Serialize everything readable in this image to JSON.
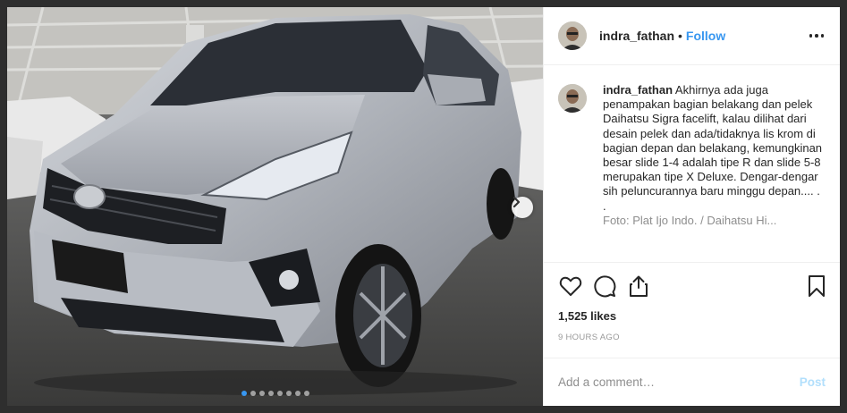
{
  "header": {
    "username": "indra_fathan",
    "separator": "•",
    "follow_label": "Follow"
  },
  "caption": {
    "username": "indra_fathan",
    "text": "Akhirnya ada juga penampakan bagian belakang dan pelek Daihatsu Sigra facelift, kalau dilihat dari desain pelek dan ada/tidaknya lis krom di bagian depan dan belakang, kemungkinan besar slide 1-4 adalah tipe R dan slide 5-8 merupakan tipe X Deluxe. Dengar-dengar sih peluncurannya baru minggu depan.... .",
    "dot_line": ".",
    "cut_line": "Foto: Plat Ijo Indo. / Daihatsu Hi..."
  },
  "stats": {
    "likes": "1,525 likes",
    "time": "9 HOURS AGO"
  },
  "comment_box": {
    "placeholder": "Add a comment…",
    "post_label": "Post"
  },
  "carousel": {
    "total_slides": 8,
    "active_index": 0
  },
  "colors": {
    "accent": "#3897f0",
    "post_disabled": "#b2dffc",
    "text": "#262626",
    "muted": "#8e8e8e"
  },
  "icons": {
    "like": "heart-icon",
    "comment": "comment-bubble-icon",
    "share": "share-icon",
    "save": "bookmark-icon",
    "more": "more-options-icon",
    "next": "chevron-right-icon"
  }
}
